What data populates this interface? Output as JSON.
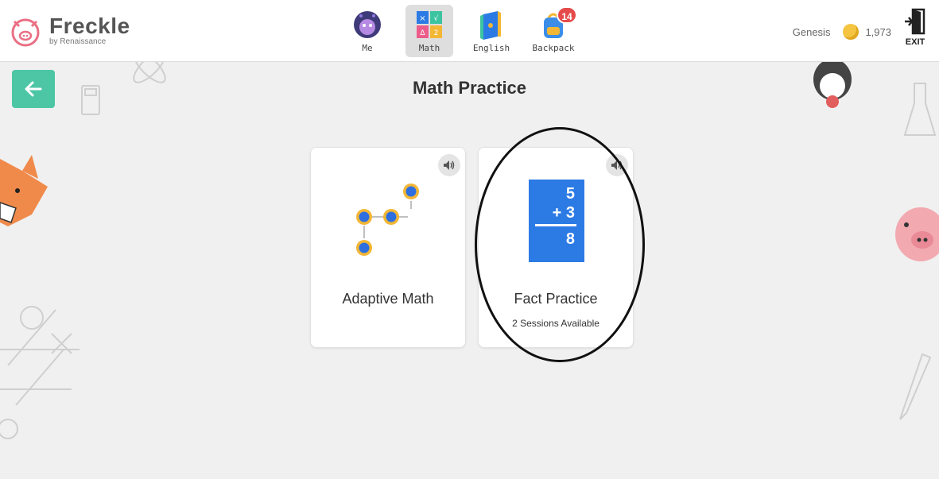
{
  "brand": {
    "name": "Freckle",
    "by": "by Renaissance"
  },
  "nav": [
    {
      "label": "Me",
      "icon": "avatar-icon"
    },
    {
      "label": "Math",
      "icon": "math-icon",
      "active": true
    },
    {
      "label": "English",
      "icon": "book-icon"
    },
    {
      "label": "Backpack",
      "icon": "backpack-icon",
      "badge": "14"
    }
  ],
  "user": {
    "name": "Genesis",
    "coins": "1,973"
  },
  "exit": {
    "label": "EXIT"
  },
  "page": {
    "title": "Math Practice"
  },
  "cards": {
    "adaptive": {
      "title": "Adaptive Math"
    },
    "fact": {
      "title": "Fact Practice",
      "subtitle": "2 Sessions Available",
      "card_top": "5",
      "card_mid": "+ 3",
      "card_answer": "8"
    }
  },
  "colors": {
    "accent": "#4dc6a6",
    "flash": "#2c7be5",
    "badge": "#e54b4b",
    "node": "#f3b735",
    "node_inner": "#2e6fe0"
  }
}
